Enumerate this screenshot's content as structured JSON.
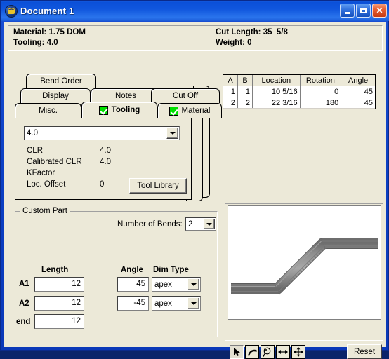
{
  "window": {
    "title": "Document 1",
    "icon": "app-icon",
    "buttons": {
      "minimize": "minimize",
      "maximize": "maximize",
      "close": "close"
    }
  },
  "info_panel": {
    "material_label": "Material: 1.75 DOM",
    "tooling_label": "Tooling: 4.0",
    "cut_length_label": "Cut Length: 35  5/8",
    "weight_label": "Weight: 0"
  },
  "bend_grid": {
    "columns": [
      "A",
      "B",
      "Location",
      "Rotation",
      "Angle"
    ],
    "rows": [
      {
        "a": "1",
        "b": "1",
        "location": "10 5/16",
        "rotation": "0",
        "angle": "45"
      },
      {
        "a": "2",
        "b": "2",
        "location": "22 3/16",
        "rotation": "180",
        "angle": "45"
      }
    ]
  },
  "tabs": {
    "row1": [
      {
        "label": "Bend Order",
        "checked": false,
        "selected": false
      }
    ],
    "row2": [
      {
        "label": "Display",
        "checked": false,
        "selected": false
      },
      {
        "label": "Notes",
        "checked": false,
        "selected": false
      },
      {
        "label": "Cut Off",
        "checked": false,
        "selected": false
      }
    ],
    "row3": [
      {
        "label": "Misc.",
        "checked": false,
        "selected": false
      },
      {
        "label": "Tooling",
        "checked": true,
        "selected": true
      },
      {
        "label": "Material",
        "checked": true,
        "selected": false
      }
    ]
  },
  "tooling_panel": {
    "tool_select_value": "4.0",
    "properties": [
      {
        "label": "CLR",
        "value": "4.0"
      },
      {
        "label": "Calibrated CLR",
        "value": "4.0"
      },
      {
        "label": "KFactor",
        "value": ""
      },
      {
        "label": "Loc. Offset",
        "value": "0"
      }
    ],
    "tool_library_button": "Tool Library"
  },
  "custom_part": {
    "legend": "Custom Part",
    "number_of_bends_label": "Number of Bends:",
    "number_of_bends_value": "2",
    "headers": {
      "length": "Length",
      "angle": "Angle",
      "dim_type": "Dim Type"
    },
    "rows": [
      {
        "name": "A1",
        "length": "12",
        "angle": "45",
        "dim_type": "apex"
      },
      {
        "name": "A2",
        "length": "12",
        "angle": "-45",
        "dim_type": "apex"
      },
      {
        "name": "end",
        "length": "12",
        "angle": "",
        "dim_type": ""
      }
    ]
  },
  "preview": {
    "toolbar": [
      {
        "name": "select-arrow-icon",
        "pressed": true
      },
      {
        "name": "rotate-icon",
        "pressed": false
      },
      {
        "name": "zoom-magnifier-icon",
        "pressed": false
      },
      {
        "name": "fit-width-icon",
        "pressed": false
      },
      {
        "name": "pan-move-icon",
        "pressed": false
      }
    ],
    "reset_button": "Reset"
  },
  "colors": {
    "title_bar": "#1056dd",
    "window_face": "#ece9d8",
    "tab_check": "#00e000",
    "part_gray": "#808080",
    "close_button": "#c63a12"
  }
}
